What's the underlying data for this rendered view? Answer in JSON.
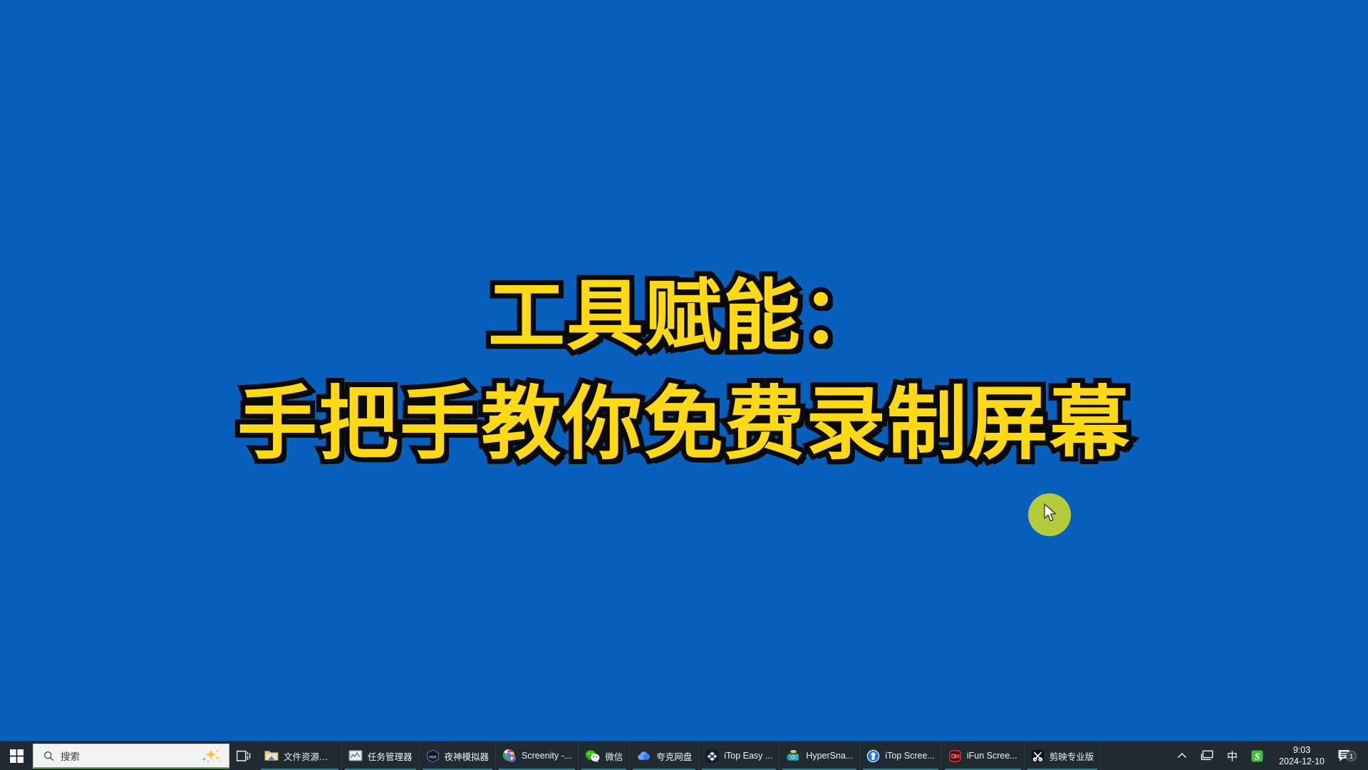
{
  "desktop": {
    "background_color": "#0860bc",
    "title": {
      "line1": "工具赋能：",
      "line2": "手把手教你免费录制屏幕",
      "text_color": "#ffd816",
      "outline_color": "#0a0a0a"
    },
    "cursor": {
      "highlight_color": "#c3d62e",
      "name": "mouse-cursor"
    }
  },
  "taskbar": {
    "background_color": "#1f2a33",
    "start": {
      "icon": "windows-logo-icon"
    },
    "search": {
      "icon": "search-icon",
      "placeholder": "搜索",
      "value": "",
      "copilot_icon": "copilot-sparkle-icon",
      "underline_color": "#63a945"
    },
    "task_view": {
      "icon": "task-view-icon"
    },
    "items": [
      {
        "label": "文件资源管...",
        "icon": "file-explorer-icon",
        "active": true
      },
      {
        "label": "任务管理器",
        "icon": "task-manager-icon",
        "active": true
      },
      {
        "label": "夜神模拟器",
        "icon": "nox-player-icon",
        "active": true
      },
      {
        "label": "Screenity -...",
        "icon": "chrome-icon",
        "active": true
      },
      {
        "label": "微信",
        "icon": "wechat-icon",
        "active": true
      },
      {
        "label": "夸克网盘",
        "icon": "quark-netdisk-icon",
        "active": true
      },
      {
        "label": "iTop Easy ...",
        "icon": "itop-easy-desktop-icon",
        "active": true
      },
      {
        "label": "HyperSna...",
        "icon": "hypersnap-icon",
        "active": true
      },
      {
        "label": "iTop Scree...",
        "icon": "itop-screen-recorder-icon",
        "active": true
      },
      {
        "label": "iFun Scree...",
        "icon": "ifun-screen-recorder-icon",
        "active": true
      },
      {
        "label": "剪映专业版",
        "icon": "jianying-capcut-icon",
        "active": true
      }
    ],
    "tray": {
      "overflow_icon": "chevron-up-icon",
      "network_icon": "network-monitor-icon",
      "ime_label": "中",
      "sogou_icon": "sogou-input-icon",
      "time": "9:03",
      "date": "2024-12-10",
      "notification_icon": "notification-icon",
      "notification_count": "1"
    }
  }
}
